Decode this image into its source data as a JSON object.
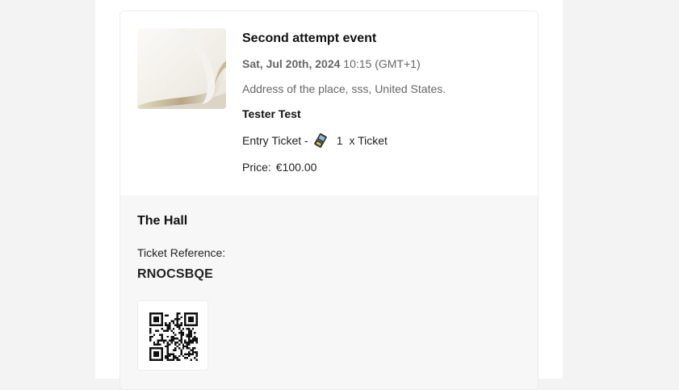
{
  "event": {
    "title": "Second attempt event",
    "date_bold": "Sat, Jul 20th, 2024",
    "time": "10:15 (GMT+1)",
    "address": "Address of the place, sss, United States.",
    "attendee": "Tester Test",
    "entry_label": "Entry Ticket -",
    "quantity": "1",
    "quantity_suffix": "x Ticket",
    "price_label": "Price:",
    "price_value": "€100.00",
    "thumbnail_icon": "event-image"
  },
  "ticket": {
    "venue": "The Hall",
    "reference_label": "Ticket Reference:",
    "reference_value": "RNOCSBQE",
    "qr_icon": "qr-code"
  },
  "colors": {
    "page_bg": "#f3f3f3",
    "card_bg": "#ffffff",
    "section_bg": "#f7f7f7",
    "muted_text": "#666666"
  }
}
